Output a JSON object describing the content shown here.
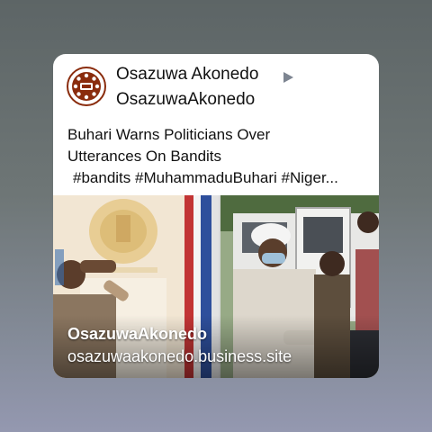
{
  "post": {
    "author_name": "Osazuwa Akonedo",
    "author_handle": "OsazuwaAkonedo",
    "text_line1": "Buhari Warns Politicians Over",
    "text_line2": "Utterances On Bandits",
    "hashtags": "#bandits #MuhammaduBuhari #Niger..."
  },
  "link_preview": {
    "site_name": "OsazuwaAkonedo",
    "url": "osazuwaakonedo.business.site"
  },
  "icons": {
    "avatar": "logo-avatar",
    "expand": "play-triangle-icon"
  },
  "colors": {
    "card_background": "#ffffff",
    "accent_logo": "#8a2c0d",
    "triangle": "#7d8591"
  }
}
